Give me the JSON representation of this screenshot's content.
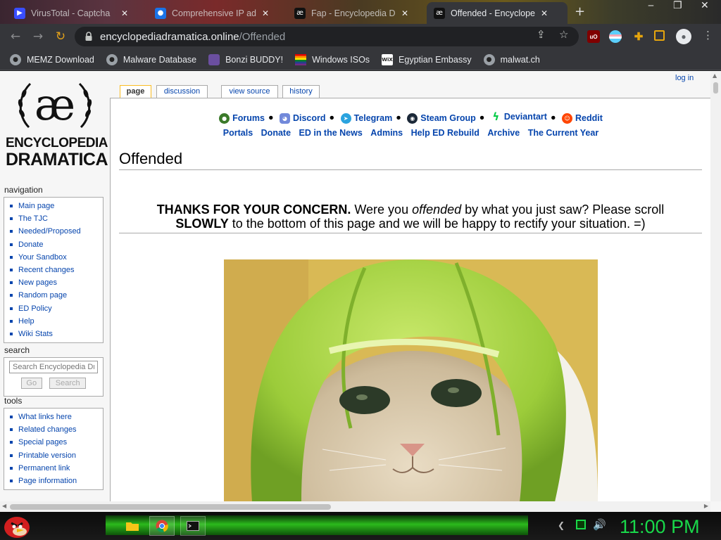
{
  "browser": {
    "tabs": [
      {
        "title": "VirusTotal - Captcha",
        "active": false
      },
      {
        "title": "Comprehensive IP addr",
        "active": false
      },
      {
        "title": "Fap - Encyclopedia Dram",
        "active": false
      },
      {
        "title": "Offended - Encyclopedia",
        "active": true
      }
    ],
    "url_host": "encyclopediadramatica.online",
    "url_path": "/Offended",
    "bookmarks": [
      {
        "label": "MEMZ Download",
        "icon": "globe-icon"
      },
      {
        "label": "Malware Database",
        "icon": "globe-icon"
      },
      {
        "label": "Bonzi BUDDY!",
        "icon": "bonzi-icon"
      },
      {
        "label": "Windows ISOs",
        "icon": "windows-icon"
      },
      {
        "label": "Egyptian Embassy",
        "icon": "wix-icon"
      },
      {
        "label": "malwat.ch",
        "icon": "globe-icon"
      }
    ],
    "extensions": {
      "ublock": "uO"
    },
    "wix_label": "WiX",
    "colors": {
      "chrome_dark": "#35363a",
      "omnibox": "#202124",
      "link": "#0645ad",
      "clock_green": "#19d84a"
    }
  },
  "site": {
    "logo": {
      "line1": "ENCYCLOPEDIA",
      "line2": "DRAMATICA",
      "emblem": "æ"
    },
    "personal": {
      "login": "log in"
    },
    "content_tabs": [
      {
        "label": "page",
        "selected": true
      },
      {
        "label": "discussion",
        "selected": false
      },
      {
        "label": "view source",
        "selected": false
      },
      {
        "label": "history",
        "selected": false
      }
    ],
    "social_links": [
      {
        "label": "Forums",
        "icon": "forums-icon"
      },
      {
        "label": "Discord",
        "icon": "discord-icon"
      },
      {
        "label": "Telegram",
        "icon": "telegram-icon"
      },
      {
        "label": "Steam Group",
        "icon": "steam-icon"
      },
      {
        "label": "Deviantart",
        "icon": "deviantart-icon"
      },
      {
        "label": "Reddit",
        "icon": "reddit-icon"
      }
    ],
    "nav_links": [
      "Portals",
      "Donate",
      "ED in the News",
      "Admins",
      "Help ED Rebuild",
      "Archive",
      "The Current Year"
    ],
    "page_title": "Offended",
    "banner": {
      "bold1": "THANKS FOR YOUR CONCERN.",
      "t1": " Were you ",
      "em": "offended",
      "t2": " by what you just saw? Please scroll",
      "bold2": "SLOWLY",
      "t3": " to the bottom of this page and we will be happy to rectify your situation. =)"
    },
    "image_subject": "cat-wearing-melon-helmet"
  },
  "sidebar": {
    "navigation": {
      "heading": "navigation",
      "items": [
        "Main page",
        "The TJC",
        "Needed/Proposed",
        "Donate",
        "Your Sandbox",
        "Recent changes",
        "New pages",
        "Random page",
        "ED Policy",
        "Help",
        "Wiki Stats"
      ]
    },
    "search": {
      "heading": "search",
      "placeholder": "Search Encyclopedia Dramatica",
      "go": "Go",
      "search": "Search"
    },
    "tools": {
      "heading": "tools",
      "items": [
        "What links here",
        "Related changes",
        "Special pages",
        "Printable version",
        "Permanent link",
        "Page information"
      ]
    }
  },
  "taskbar": {
    "clock": "11:00 PM"
  }
}
